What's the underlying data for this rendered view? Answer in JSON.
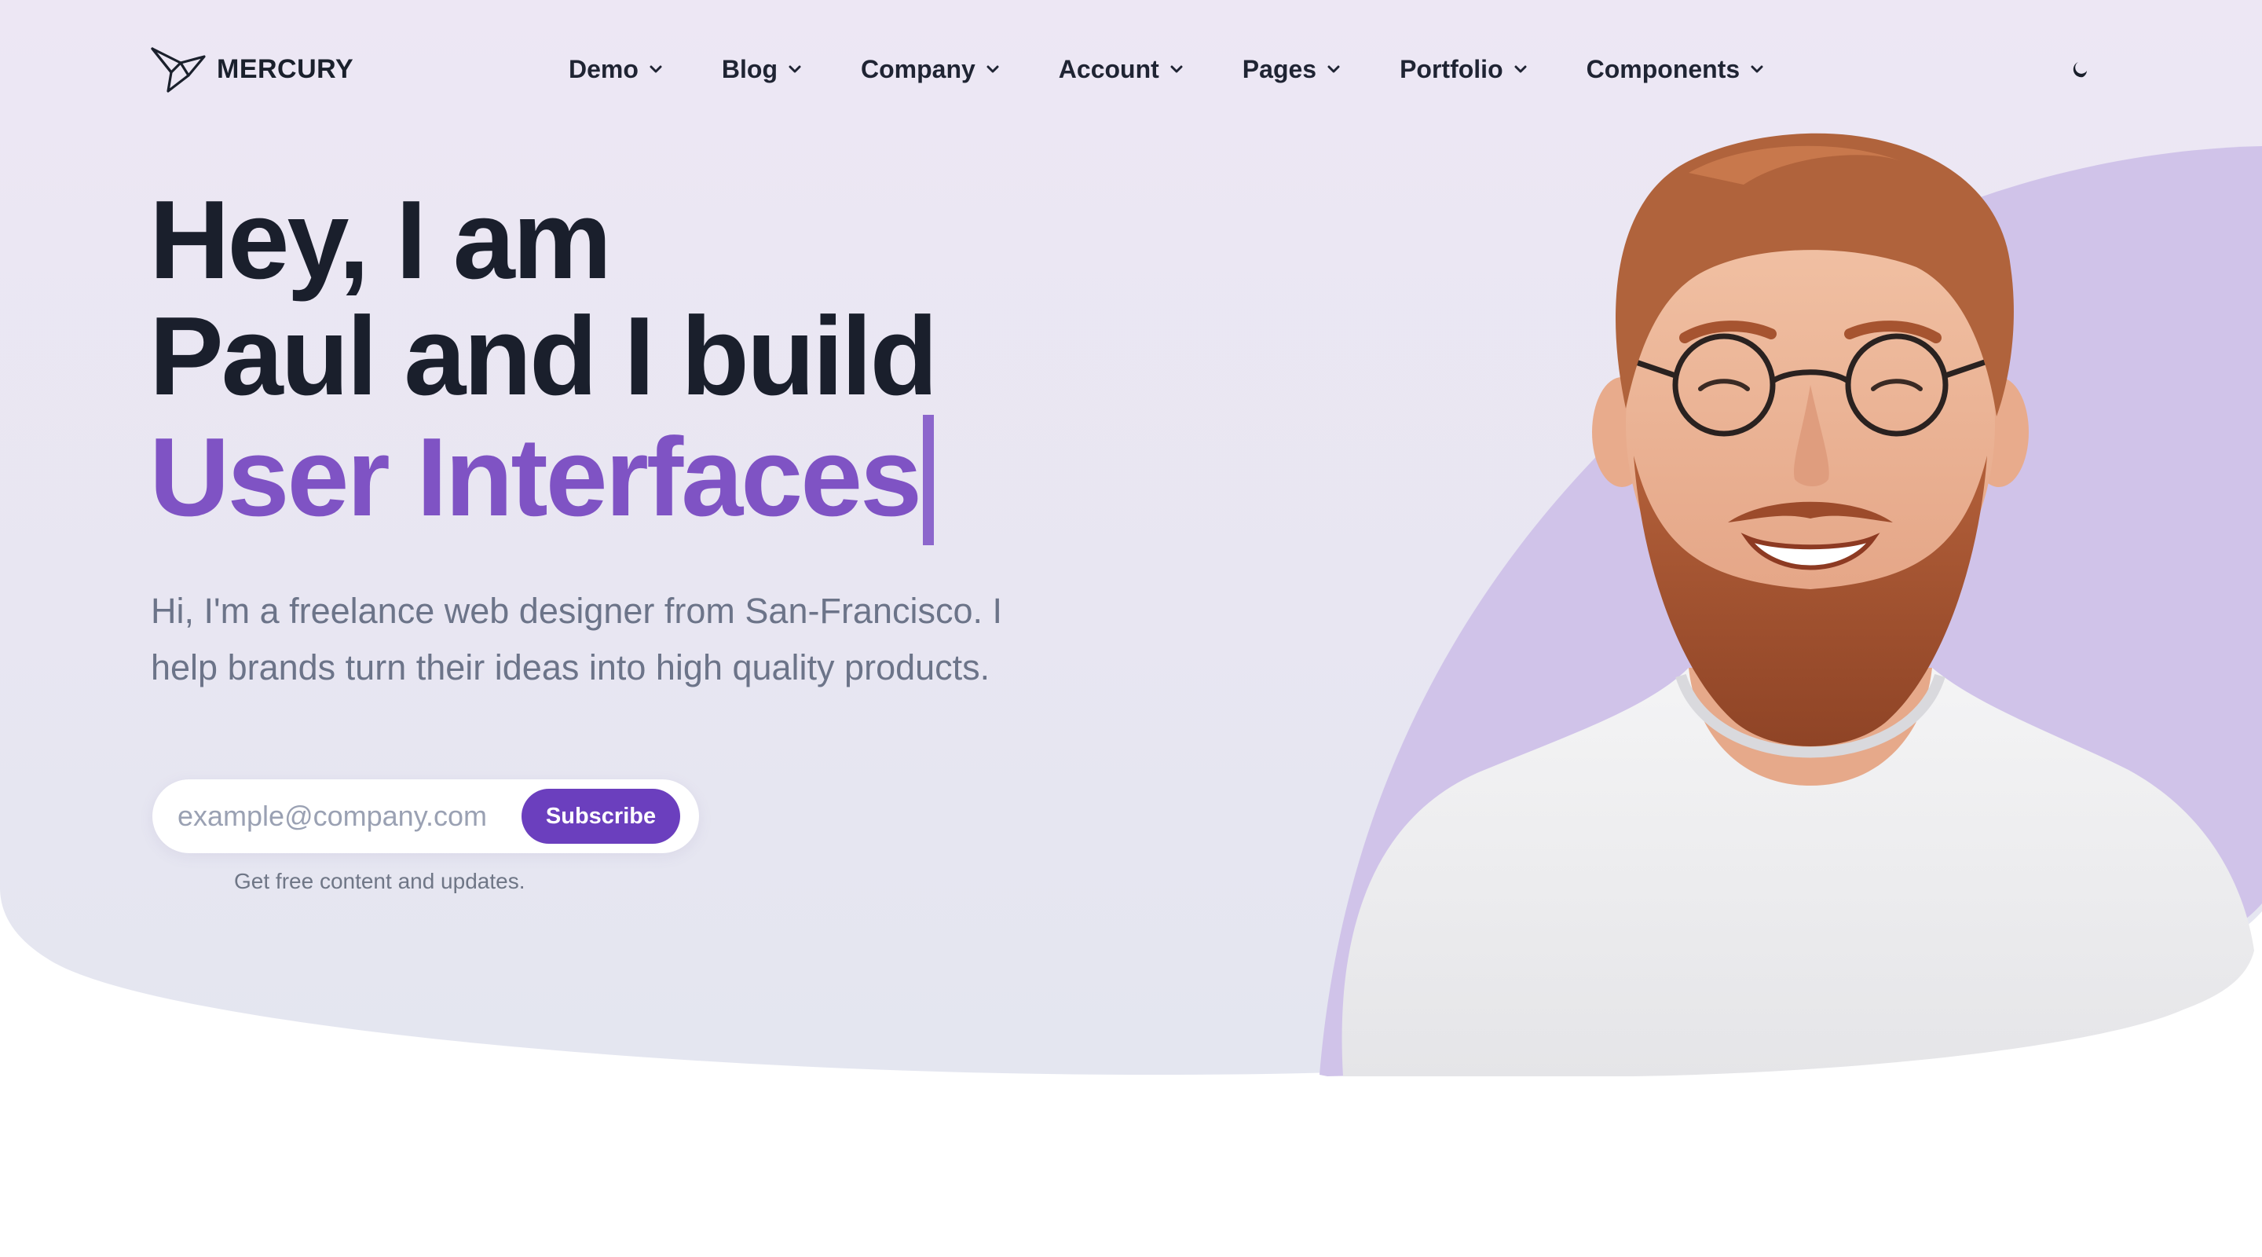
{
  "brand": {
    "name": "MERCURY",
    "logo_icon": "paper-bird-icon"
  },
  "nav": {
    "items": [
      {
        "label": "Demo"
      },
      {
        "label": "Blog"
      },
      {
        "label": "Company"
      },
      {
        "label": "Account"
      },
      {
        "label": "Pages"
      },
      {
        "label": "Portfolio"
      },
      {
        "label": "Components"
      }
    ],
    "dropdown_icon": "chevron-down-icon",
    "theme_toggle_icon": "moon-icon"
  },
  "hero": {
    "title_line1": "Hey, I am",
    "title_line2": "Paul and I build",
    "title_highlight": "User Interfaces",
    "description": "Hi, I'm a freelance web designer from San-Francisco. I help brands turn their ideas into high quality products."
  },
  "subscribe": {
    "placeholder": "example@company.com",
    "button_label": "Subscribe",
    "note": "Get free content and updates."
  },
  "colors": {
    "accent": "#6b3fbe",
    "highlight": "#7f53c4",
    "hero_bg_top": "#ede7f4",
    "hero_bg_bottom": "#e4e6f0",
    "blob": "#d0c3e9"
  }
}
